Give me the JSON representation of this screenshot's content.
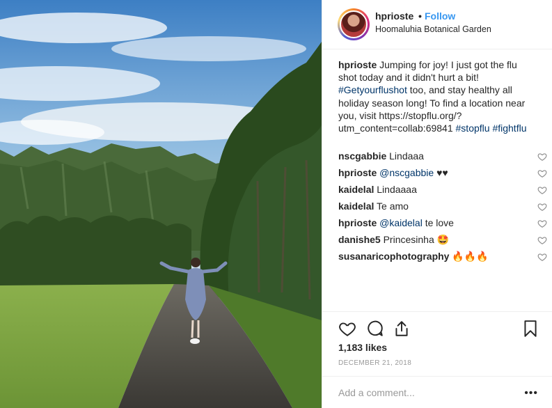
{
  "post": {
    "username": "hprioste",
    "separator": "•",
    "follow_label": "Follow",
    "location": "Hoomaluhia Botanical Garden",
    "caption_user": "hprioste",
    "caption_part1": "Jumping for joy! I just got the flu shot today and it didn't hurt a bit!",
    "caption_tag1": "#Getyourflushot",
    "caption_part2": "too, and stay healthy all holiday season long! To find a location near you, visit https://stopflu.org/?utm_content=collab:69841",
    "caption_tag2": "#stopflu",
    "caption_tag3": "#fightflu"
  },
  "comments": [
    {
      "user": "nscgabbie",
      "mention": "",
      "text": "Lindaaa"
    },
    {
      "user": "hprioste",
      "mention": "@nscgabbie",
      "text": "♥♥"
    },
    {
      "user": "kaidelal",
      "mention": "",
      "text": "Lindaaaa"
    },
    {
      "user": "kaidelal",
      "mention": "",
      "text": "Te amo"
    },
    {
      "user": "hprioste",
      "mention": "@kaidelal",
      "text": "te love"
    },
    {
      "user": "danishe5",
      "mention": "",
      "text": "Princesinha 🤩"
    },
    {
      "user": "susanaricophotography",
      "mention": "",
      "text": "🔥🔥🔥"
    }
  ],
  "stats": {
    "likes": "1,183 likes",
    "date": "DECEMBER 21, 2018"
  },
  "composer": {
    "placeholder": "Add a comment...",
    "more": "•••"
  },
  "icons": {
    "like": "heart-icon",
    "comment": "speech-bubble-icon",
    "share": "share-icon",
    "save": "bookmark-icon"
  }
}
